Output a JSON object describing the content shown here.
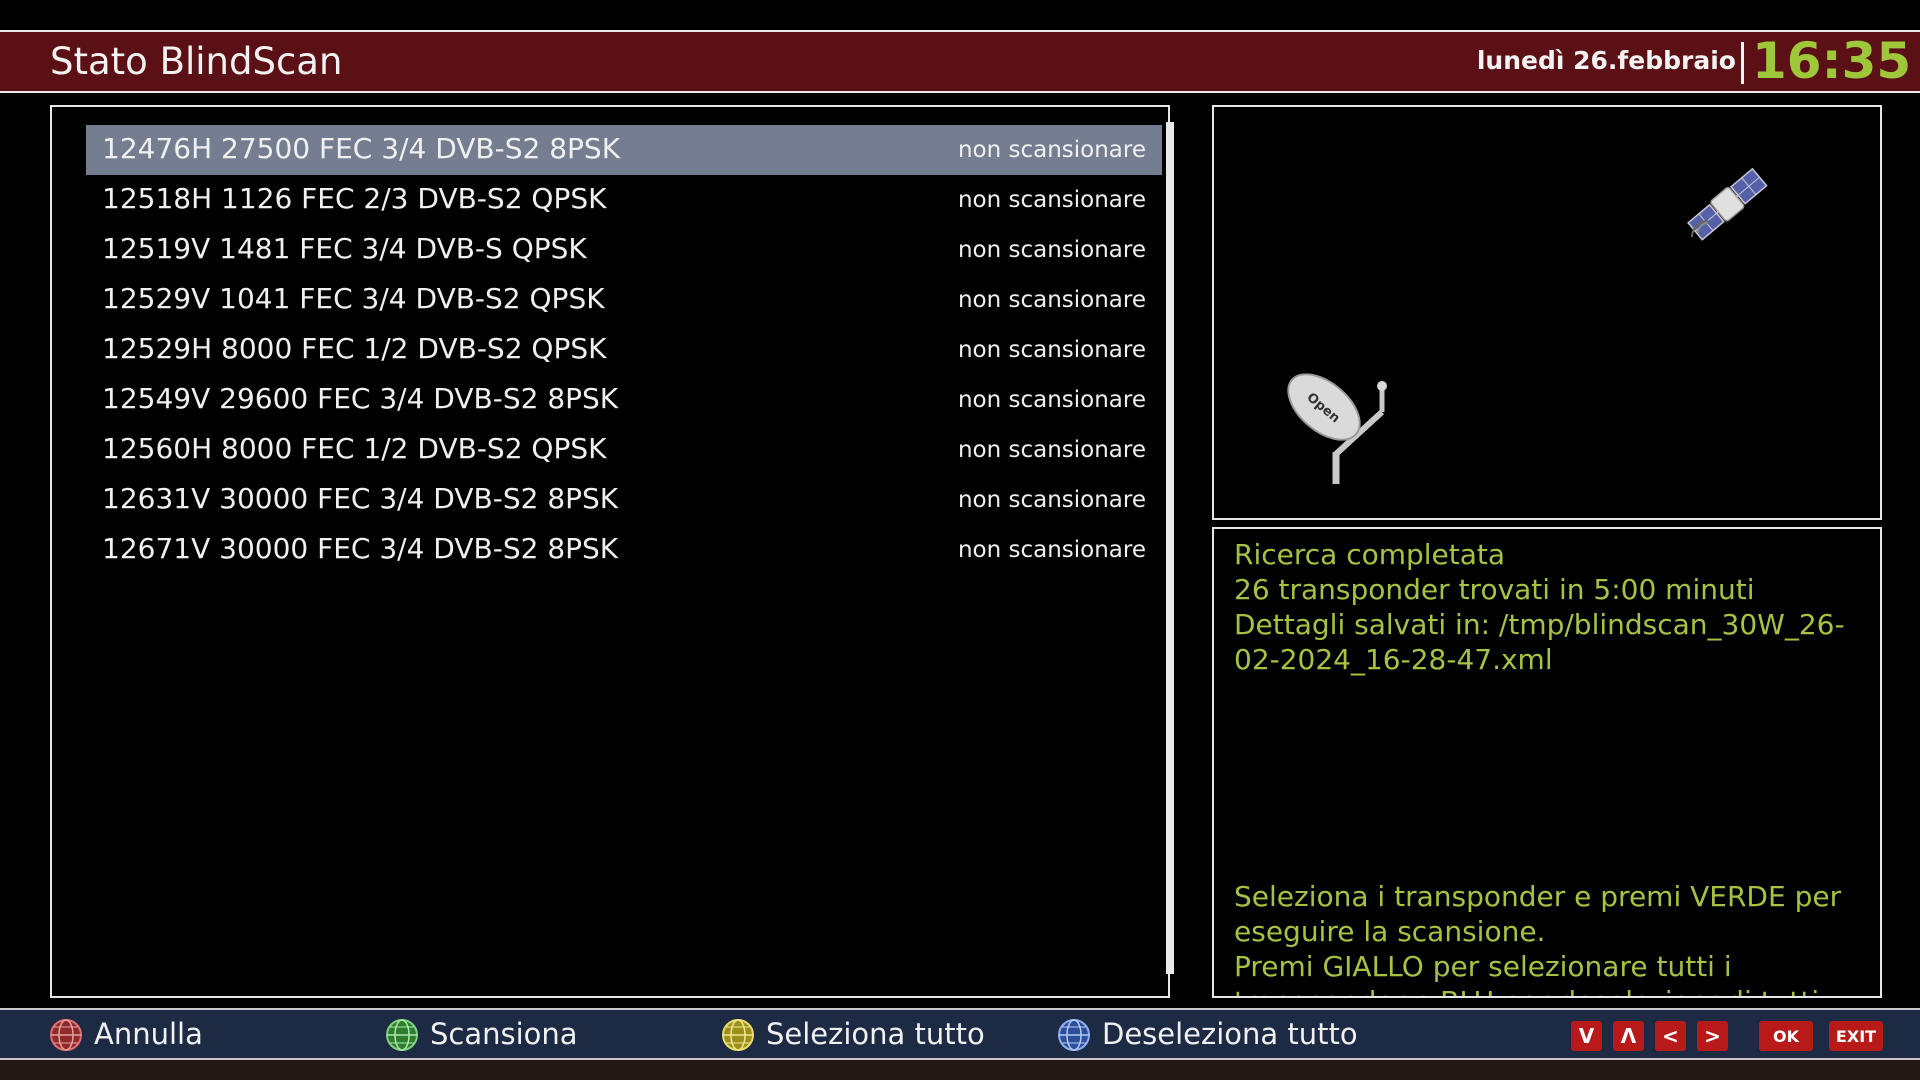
{
  "header": {
    "title": "Stato BlindScan",
    "date": "lunedì 26.febbraio",
    "time": "16:35"
  },
  "transponders": [
    {
      "label": "12476H 27500 FEC 3/4 DVB-S2 8PSK",
      "status": "non scansionare",
      "selected": true
    },
    {
      "label": "12518H 1126 FEC 2/3 DVB-S2 QPSK",
      "status": "non scansionare"
    },
    {
      "label": "12519V 1481 FEC 3/4 DVB-S QPSK",
      "status": "non scansionare"
    },
    {
      "label": "12529V 1041 FEC 3/4 DVB-S2 QPSK",
      "status": "non scansionare"
    },
    {
      "label": "12529H 8000 FEC 1/2 DVB-S2 QPSK",
      "status": "non scansionare"
    },
    {
      "label": "12549V 29600 FEC 3/4 DVB-S2 8PSK",
      "status": "non scansionare"
    },
    {
      "label": "12560H 8000 FEC 1/2 DVB-S2 QPSK",
      "status": "non scansionare"
    },
    {
      "label": "12631V 30000 FEC 3/4 DVB-S2 8PSK",
      "status": "non scansionare"
    },
    {
      "label": "12671V 30000 FEC 3/4 DVB-S2 8PSK",
      "status": "non scansionare"
    }
  ],
  "info": {
    "line1": "Ricerca completata",
    "line2": "26 transponder trovati in 5:00 minuti",
    "line3": "Dettagli salvati in: /tmp/blindscan_30W_26-02-2024_16-28-47.xml",
    "help1": "Seleziona i transponder e premi VERDE per eseguire la scansione.",
    "help2": "Premi GIALLO per selezionare tutti i transponder e BLU per deselezionarli tutti."
  },
  "graphic": {
    "satellite_icon": "satellite-icon",
    "dish_icon": "satellite-dish-icon",
    "dish_text": "Open"
  },
  "footer": {
    "buttons": [
      {
        "label": "Annulla",
        "color": "#c0392b",
        "icon": "red-button-icon"
      },
      {
        "label": "Scansiona",
        "color": "#3fae3f",
        "icon": "green-button-icon"
      },
      {
        "label": "Seleziona tutto",
        "color": "#d4c234",
        "icon": "yellow-button-icon"
      },
      {
        "label": "Deseleziona tutto",
        "color": "#3b6fd6",
        "icon": "blue-button-icon"
      }
    ],
    "keys": {
      "down": "V",
      "up": "Λ",
      "left": "<",
      "right": ">",
      "ok": "OK",
      "exit": "EXIT"
    }
  },
  "colors": {
    "header_bg": "#5b1015",
    "clock": "#9ec83a",
    "info_text": "#a6c243",
    "selection": "#747e90",
    "footer_bg": "#1d2a44",
    "key_bg": "#b81a1a"
  }
}
